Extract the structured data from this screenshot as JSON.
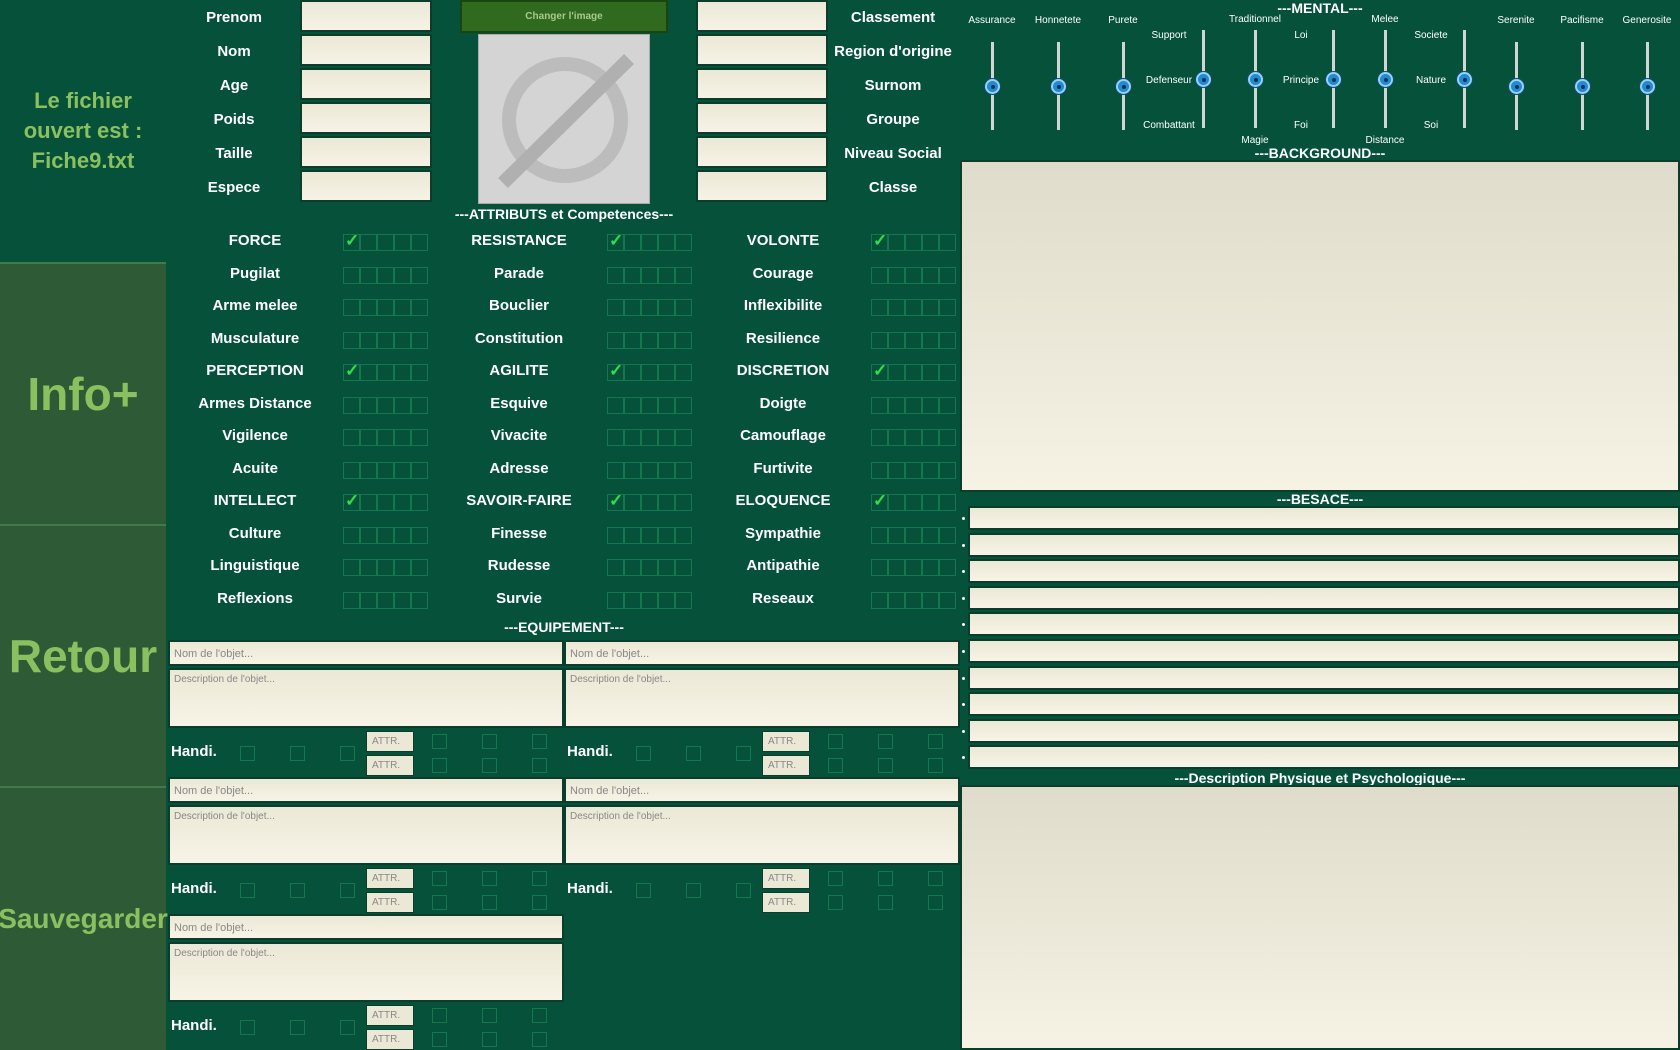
{
  "file_info": {
    "line1": "Le fichier",
    "line2": "ouvert est :",
    "line3": "Fiche9.txt"
  },
  "sidebar": {
    "info": "Info+",
    "back": "Retour",
    "save": "Sauvegarder"
  },
  "identity_left": [
    "Prenom",
    "Nom",
    "Age",
    "Poids",
    "Taille",
    "Espece"
  ],
  "identity_right": [
    "Classement",
    "Region d'origine",
    "Surnom",
    "Groupe",
    "Niveau Social",
    "Classe"
  ],
  "image": {
    "change_button": "Changer l'image",
    "placeholder_icon": "no-image-icon"
  },
  "attributes": {
    "header": "---ATTRIBUTS et Competences---",
    "columns": [
      [
        {
          "label": "FORCE",
          "checked": 1
        },
        {
          "label": "Pugilat",
          "checked": 0
        },
        {
          "label": "Arme melee",
          "checked": 0
        },
        {
          "label": "Musculature",
          "checked": 0
        },
        {
          "label": "PERCEPTION",
          "checked": 1
        },
        {
          "label": "Armes Distance",
          "checked": 0
        },
        {
          "label": "Vigilence",
          "checked": 0
        },
        {
          "label": "Acuite",
          "checked": 0
        },
        {
          "label": "INTELLECT",
          "checked": 1
        },
        {
          "label": "Culture",
          "checked": 0
        },
        {
          "label": "Linguistique",
          "checked": 0
        },
        {
          "label": "Reflexions",
          "checked": 0
        }
      ],
      [
        {
          "label": "RESISTANCE",
          "checked": 1
        },
        {
          "label": "Parade",
          "checked": 0
        },
        {
          "label": "Bouclier",
          "checked": 0
        },
        {
          "label": "Constitution",
          "checked": 0
        },
        {
          "label": "AGILITE",
          "checked": 1
        },
        {
          "label": "Esquive",
          "checked": 0
        },
        {
          "label": "Vivacite",
          "checked": 0
        },
        {
          "label": "Adresse",
          "checked": 0
        },
        {
          "label": "SAVOIR-FAIRE",
          "checked": 1
        },
        {
          "label": "Finesse",
          "checked": 0
        },
        {
          "label": "Rudesse",
          "checked": 0
        },
        {
          "label": "Survie",
          "checked": 0
        }
      ],
      [
        {
          "label": "VOLONTE",
          "checked": 1
        },
        {
          "label": "Courage",
          "checked": 0
        },
        {
          "label": "Inflexibilite",
          "checked": 0
        },
        {
          "label": "Resilience",
          "checked": 0
        },
        {
          "label": "DISCRETION",
          "checked": 1
        },
        {
          "label": "Doigte",
          "checked": 0
        },
        {
          "label": "Camouflage",
          "checked": 0
        },
        {
          "label": "Furtivite",
          "checked": 0
        },
        {
          "label": "ELOQUENCE",
          "checked": 1
        },
        {
          "label": "Sympathie",
          "checked": 0
        },
        {
          "label": "Antipathie",
          "checked": 0
        },
        {
          "label": "Reseaux",
          "checked": 0
        }
      ]
    ]
  },
  "equipment": {
    "header": "---EQUIPEMENT---",
    "name_placeholder": "Nom de l'objet...",
    "desc_placeholder": "Description de l'objet...",
    "handi_label": "Handi.",
    "attr_placeholder": "ATTR."
  },
  "mental": {
    "header": "---MENTAL---",
    "sliders_simple": [
      {
        "label": "Assurance",
        "value": 0.5
      },
      {
        "label": "Honnetete",
        "value": 0.5
      },
      {
        "label": "Purete",
        "value": 0.5
      },
      {
        "label": "Serenite",
        "value": 0.5
      },
      {
        "label": "Pacifisme",
        "value": 0.5
      },
      {
        "label": "Generosite",
        "value": 0.5
      }
    ],
    "tri_groups": [
      {
        "top": "Support",
        "mid": "Defenseur",
        "bottom": "Combattant",
        "slider_label": "Traditionnel",
        "bottom_slider_label": "Magie",
        "value": 0.5
      },
      {
        "top": "Loi",
        "mid": "Principe",
        "bottom": "Foi",
        "slider_label": "Melee",
        "bottom_slider_label": "Distance",
        "value": 0.5
      },
      {
        "top": "Societe",
        "mid": "Nature",
        "bottom": "Soi",
        "value": 0.5
      }
    ]
  },
  "background": {
    "header": "---BACKGROUND---"
  },
  "besace": {
    "header": "---BESACE---",
    "rows": 10
  },
  "description": {
    "header": "---Description Physique et Psychologique---"
  }
}
